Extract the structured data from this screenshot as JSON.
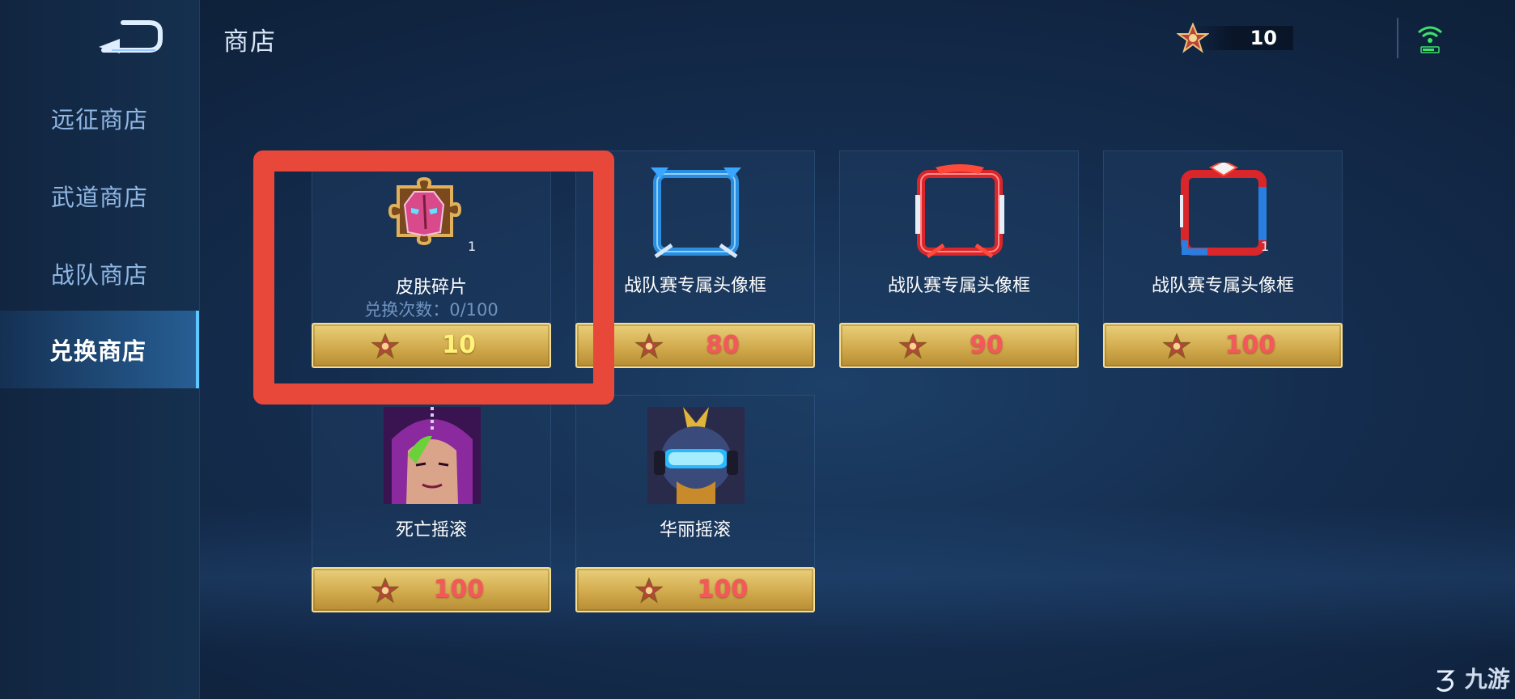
{
  "header": {
    "title": "商店",
    "currency_amount": "10",
    "currency_icon": "star-medal-icon"
  },
  "sidebar": {
    "items": [
      {
        "label": "远征商店",
        "active": false
      },
      {
        "label": "武道商店",
        "active": false
      },
      {
        "label": "战队商店",
        "active": false
      },
      {
        "label": "兑换商店",
        "active": true
      }
    ]
  },
  "items": [
    {
      "name": "皮肤碎片",
      "subtitle": "兑换次数：0/100",
      "price": "10",
      "quantity": "1",
      "icon": "skin-fragment-icon",
      "affordable": true
    },
    {
      "name": "战队赛专属头像框",
      "price": "80",
      "icon": "blue-avatar-frame-icon",
      "affordable": false
    },
    {
      "name": "战队赛专属头像框",
      "price": "90",
      "icon": "red-silver-avatar-frame-icon",
      "affordable": false
    },
    {
      "name": "战队赛专属头像框",
      "price": "100",
      "quantity": "1",
      "icon": "red-blue-avatar-frame-icon",
      "affordable": false
    },
    {
      "name": "死亡摇滚",
      "price": "100",
      "icon": "death-rock-skin-portrait",
      "affordable": false
    },
    {
      "name": "华丽摇滚",
      "price": "100",
      "icon": "glam-rock-skin-portrait",
      "affordable": false
    }
  ],
  "colors": {
    "accent": "#5fc6ff",
    "highlight": "#e8483a",
    "price_affordable": "#fff27a",
    "price_insufficient": "#f4585a"
  },
  "watermark": "九游"
}
